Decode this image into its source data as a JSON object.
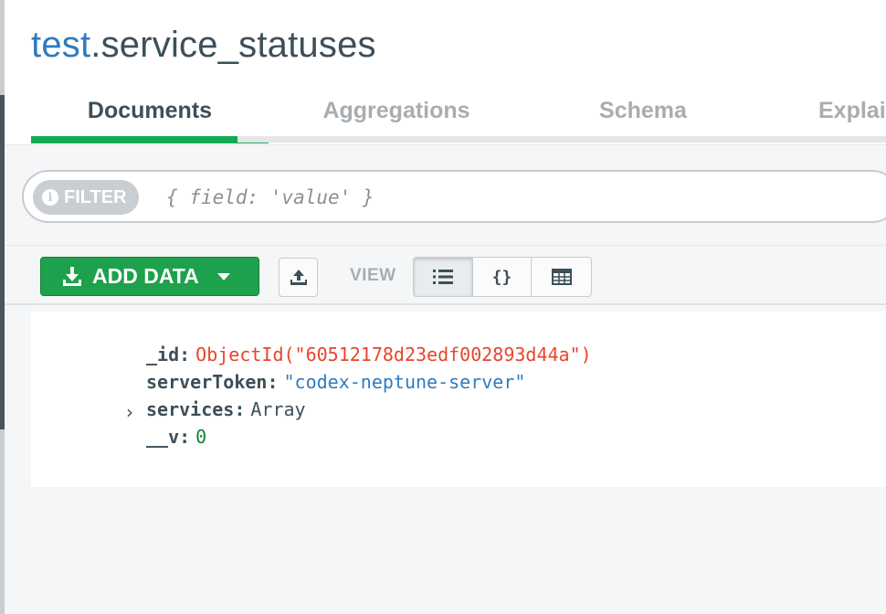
{
  "collection": {
    "database": "test",
    "separator": ".",
    "name": "service_statuses"
  },
  "tabs": [
    {
      "label": "Documents",
      "active": true
    },
    {
      "label": "Aggregations",
      "active": false
    },
    {
      "label": "Schema",
      "active": false
    },
    {
      "label": "Explai",
      "active": false
    }
  ],
  "filter": {
    "chip_label": "FILTER",
    "info_icon": "i",
    "placeholder": "{ field: 'value' }"
  },
  "toolbar": {
    "add_data_label": "ADD DATA",
    "view_label": "VIEW",
    "view_buttons": [
      {
        "icon": "list-icon",
        "glyph": "",
        "active": true
      },
      {
        "icon": "json-icon",
        "glyph": "{}",
        "active": false
      },
      {
        "icon": "table-icon",
        "glyph": "",
        "active": false
      }
    ]
  },
  "document": {
    "fields": [
      {
        "key": "_id",
        "value": "ObjectId(\"60512178d23edf002893d44a\")",
        "type": "objectid"
      },
      {
        "key": "serverToken",
        "value": "\"codex-neptune-server\"",
        "type": "string"
      },
      {
        "key": "services",
        "value": "Array",
        "type": "array",
        "expandable": true
      },
      {
        "key": "__v",
        "value": "0",
        "type": "number"
      }
    ],
    "expand_glyph": "›"
  },
  "colors": {
    "accent_green": "#13aa52",
    "button_green": "#1ea14c",
    "db_blue": "#2f7bbf",
    "objectid_red": "#e8452c",
    "number_green": "#13803a",
    "text_dark": "#3d4f58",
    "text_muted": "#a8adb2"
  }
}
